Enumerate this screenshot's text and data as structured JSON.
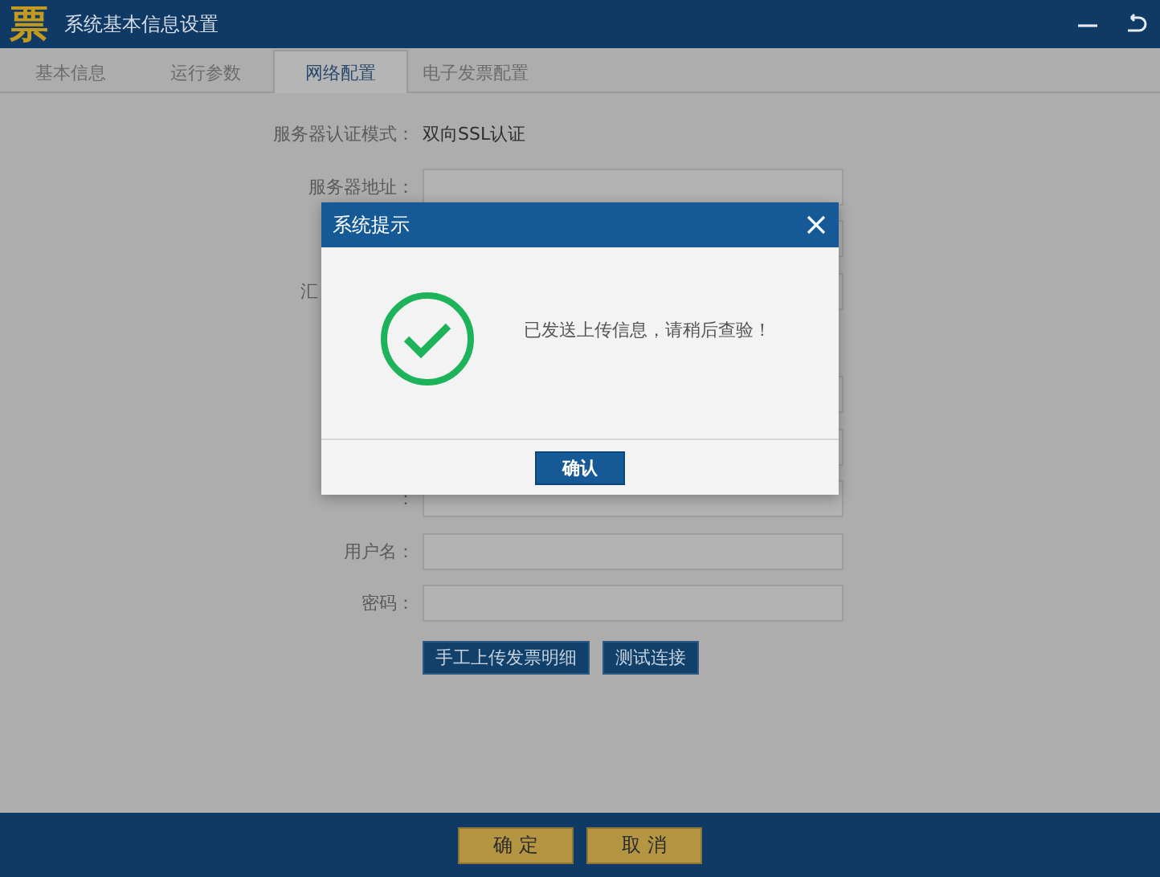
{
  "window": {
    "logo": "票",
    "title": "系统基本信息设置"
  },
  "tabs": [
    {
      "label": "基本信息",
      "selected": false
    },
    {
      "label": "运行参数",
      "selected": false
    },
    {
      "label": "网络配置",
      "selected": true
    },
    {
      "label": "电子发票配置",
      "selected": false
    }
  ],
  "auth_mode": {
    "label": "服务器认证模式：",
    "value": "双向SSL认证"
  },
  "form_rows_top": [
    {
      "kind": "field",
      "label": "服务器地址："
    },
    {
      "kind": "field"
    },
    {
      "kind": "cut",
      "label": "汇"
    }
  ],
  "form_rows_bottom": [
    {
      "kind": "field"
    },
    {
      "kind": "field"
    },
    {
      "kind": "field",
      "label": "："
    },
    {
      "kind": "field",
      "label": "用户名："
    },
    {
      "kind": "field",
      "label": "密码："
    }
  ],
  "actions": [
    "手工上传发票明细",
    "测试连接"
  ],
  "dialog": {
    "title": "系统提示",
    "message": "已发送上传信息，请稍后查验！",
    "button": "确认"
  },
  "footer_buttons": [
    "确 定",
    "取 消"
  ]
}
